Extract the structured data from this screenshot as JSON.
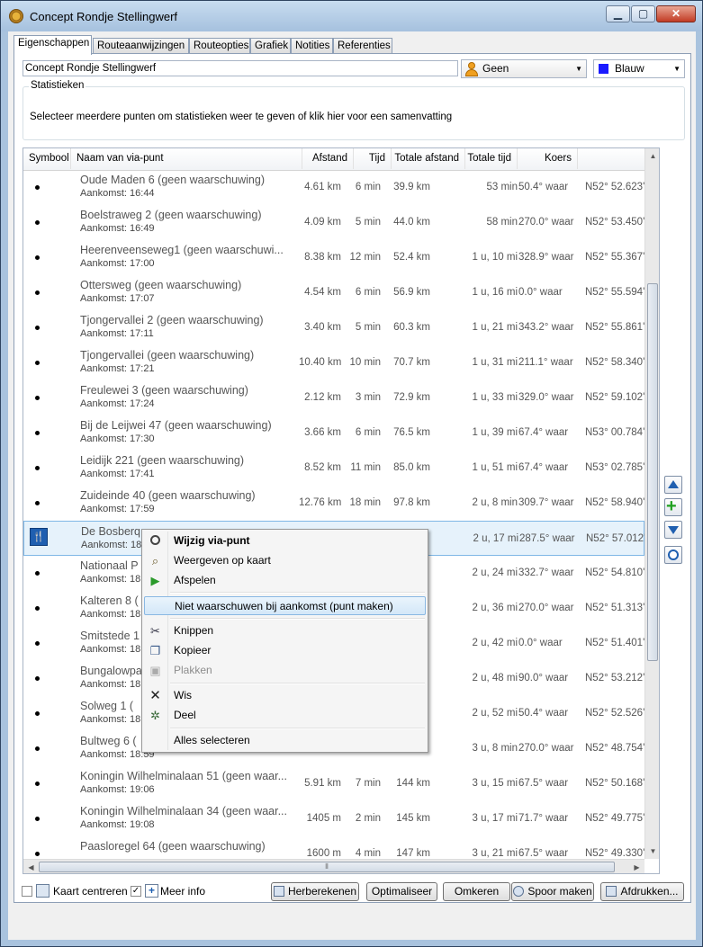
{
  "window": {
    "title": "Concept Rondje Stellingwerf"
  },
  "tabs": [
    "Eigenschappen",
    "Routeaanwijzingen",
    "Routeopties",
    "Grafiek",
    "Notities",
    "Referenties"
  ],
  "properties": {
    "name": "Concept Rondje Stellingwerf",
    "warning": "Geen",
    "color": "Blauw",
    "color_hex": "#1a1aff"
  },
  "stats": {
    "title": "Statistieken",
    "text": "Selecteer meerdere punten om statistieken weer te geven of klik hier voor een samenvatting"
  },
  "columns": {
    "symbool": "Symbool",
    "naam": "Naam van via-punt",
    "afstand": "Afstand",
    "tijd": "Tijd",
    "totale_afstand": "Totale afstand",
    "totale_tijd": "Totale tijd",
    "koers": "Koers"
  },
  "rows": [
    {
      "name": "Oude Maden 6 (geen waarschuwing)",
      "arrival": "Aankomst: 16:44",
      "afstand": "4.61 km",
      "tijd": "6 min",
      "totale_afstand": "39.9 km",
      "totale_tijd": "53 min",
      "koers": "50.4° waar",
      "coord": "N52° 52.623'"
    },
    {
      "name": "Boelstraweg 2 (geen waarschuwing)",
      "arrival": "Aankomst: 16:49",
      "afstand": "4.09 km",
      "tijd": "5 min",
      "totale_afstand": "44.0 km",
      "totale_tijd": "58 min",
      "koers": "270.0° waar",
      "coord": "N52° 53.450'"
    },
    {
      "name": "Heerenveenseweg1  (geen waarschuwi...",
      "arrival": "Aankomst: 17:00",
      "afstand": "8.38 km",
      "tijd": "12 min",
      "totale_afstand": "52.4 km",
      "totale_tijd": "1 u, 10 mi",
      "koers": "328.9° waar",
      "coord": "N52° 55.367'"
    },
    {
      "name": "Ottersweg (geen waarschuwing)",
      "arrival": "Aankomst: 17:07",
      "afstand": "4.54 km",
      "tijd": "6 min",
      "totale_afstand": "56.9 km",
      "totale_tijd": "1 u, 16 mi",
      "koers": "0.0° waar",
      "coord": "N52° 55.594'"
    },
    {
      "name": "Tjongervallei 2 (geen waarschuwing)",
      "arrival": "Aankomst: 17:11",
      "afstand": "3.40 km",
      "tijd": "5 min",
      "totale_afstand": "60.3 km",
      "totale_tijd": "1 u, 21 mi",
      "koers": "343.2° waar",
      "coord": "N52° 55.861'"
    },
    {
      "name": "Tjongervallei (geen waarschuwing)",
      "arrival": "Aankomst: 17:21",
      "afstand": "10.40 km",
      "tijd": "10 min",
      "totale_afstand": "70.7 km",
      "totale_tijd": "1 u, 31 mi",
      "koers": "211.1° waar",
      "coord": "N52° 58.340'"
    },
    {
      "name": "Freulewei 3 (geen waarschuwing)",
      "arrival": "Aankomst: 17:24",
      "afstand": "2.12 km",
      "tijd": "3 min",
      "totale_afstand": "72.9 km",
      "totale_tijd": "1 u, 33 mi",
      "koers": "329.0° waar",
      "coord": "N52° 59.102'"
    },
    {
      "name": "Bij de Leijwei 47 (geen waarschuwing)",
      "arrival": "Aankomst: 17:30",
      "afstand": "3.66 km",
      "tijd": "6 min",
      "totale_afstand": "76.5 km",
      "totale_tijd": "1 u, 39 mi",
      "koers": "67.4° waar",
      "coord": "N53° 00.784'"
    },
    {
      "name": "Leidijk 221 (geen waarschuwing)",
      "arrival": "Aankomst: 17:41",
      "afstand": "8.52 km",
      "tijd": "11 min",
      "totale_afstand": "85.0 km",
      "totale_tijd": "1 u, 51 mi",
      "koers": "67.4° waar",
      "coord": "N53° 02.785'"
    },
    {
      "name": "Zuideinde 40 (geen waarschuwing)",
      "arrival": "Aankomst: 17:59",
      "afstand": "12.76 km",
      "tijd": "18 min",
      "totale_afstand": "97.8 km",
      "totale_tijd": "2 u, 8 min",
      "koers": "309.7° waar",
      "coord": "N52° 58.940'"
    },
    {
      "name": "De Bosberq",
      "arrival": "Aankomst: 18",
      "afstand": "",
      "tijd": "",
      "totale_afstand": "",
      "totale_tijd": "2 u, 17 mi",
      "koers": "287.5° waar",
      "coord": "N52° 57.012'",
      "selected": true
    },
    {
      "name": "Nationaal P",
      "arrival": "Aankomst: 18",
      "afstand": "",
      "tijd": "",
      "totale_afstand": "",
      "totale_tijd": "2 u, 24 mi",
      "koers": "332.7° waar",
      "coord": "N52° 54.810'"
    },
    {
      "name": "Kalteren 8 (",
      "arrival": "Aankomst: 18",
      "afstand": "",
      "tijd": "",
      "totale_afstand": "",
      "totale_tijd": "2 u, 36 mi",
      "koers": "270.0° waar",
      "coord": "N52° 51.313'"
    },
    {
      "name": "Smitstede 1",
      "arrival": "Aankomst: 18",
      "afstand": "",
      "tijd": "",
      "totale_afstand": "",
      "totale_tijd": "2 u, 42 mi",
      "koers": "0.0° waar",
      "coord": "N52° 51.401'"
    },
    {
      "name": "Bungalowpa",
      "arrival": "Aankomst: 18",
      "afstand": "",
      "tijd": "",
      "totale_afstand": "",
      "totale_tijd": "2 u, 48 mi",
      "koers": "90.0° waar",
      "coord": "N52° 53.212'"
    },
    {
      "name": "Solweg 1 (",
      "arrival": "Aankomst: 18",
      "afstand": "",
      "tijd": "",
      "totale_afstand": "",
      "totale_tijd": "2 u, 52 mi",
      "koers": "50.4° waar",
      "coord": "N52° 52.526'"
    },
    {
      "name": "Bultweg 6 (",
      "arrival": "Aankomst: 18:59",
      "afstand": "",
      "tijd": "",
      "totale_afstand": "",
      "totale_tijd": "3 u, 8 min",
      "koers": "270.0° waar",
      "coord": "N52° 48.754'"
    },
    {
      "name": "Koningin  Wilhelminalaan  51  (geen waar...",
      "arrival": "Aankomst: 19:06",
      "afstand": "5.91 km",
      "tijd": "7 min",
      "totale_afstand": "144 km",
      "totale_tijd": "3 u, 15 mi",
      "koers": "67.5° waar",
      "coord": "N52° 50.168'"
    },
    {
      "name": "Koningin  Wilhelminalaan  34  (geen waar...",
      "arrival": "Aankomst: 19:08",
      "afstand": "1405 m",
      "tijd": "2 min",
      "totale_afstand": "145 km",
      "totale_tijd": "3 u, 17 mi",
      "koers": "71.7° waar",
      "coord": "N52° 49.775'"
    },
    {
      "name": "Paasloregel 64 (geen waarschuwing)",
      "arrival": "",
      "afstand": "1600 m",
      "tijd": "4 min",
      "totale_afstand": "147 km",
      "totale_tijd": "3 u, 21 mi",
      "koers": "67.5° waar",
      "coord": "N52° 49.330'"
    }
  ],
  "context_menu": {
    "items": [
      {
        "label": "Wijzig via-punt",
        "icon": "clock-icon"
      },
      {
        "label": "Weergeven op kaart",
        "icon": "map-view-icon"
      },
      {
        "label": "Afspelen",
        "icon": "play-icon"
      },
      {
        "label": "Niet waarschuwen bij aankomst (punt maken)",
        "icon": ""
      },
      {
        "label": "Knippen",
        "icon": "scissors-icon"
      },
      {
        "label": "Kopieer",
        "icon": "copy-icon"
      },
      {
        "label": "Plakken",
        "icon": "paste-icon"
      },
      {
        "label": "Wis",
        "icon": "delete-icon"
      },
      {
        "label": "Deel",
        "icon": "split-icon"
      },
      {
        "label": "Alles selecteren",
        "icon": ""
      }
    ]
  },
  "bottom": {
    "kaart_centreren": "Kaart centreren",
    "meer_info": "Meer info",
    "herberekenen": "Herberekenen",
    "optimaliseer": "Optimaliseer",
    "omkeren": "Omkeren",
    "spoor_maken": "Spoor maken",
    "afdrukken": "Afdrukken..."
  }
}
